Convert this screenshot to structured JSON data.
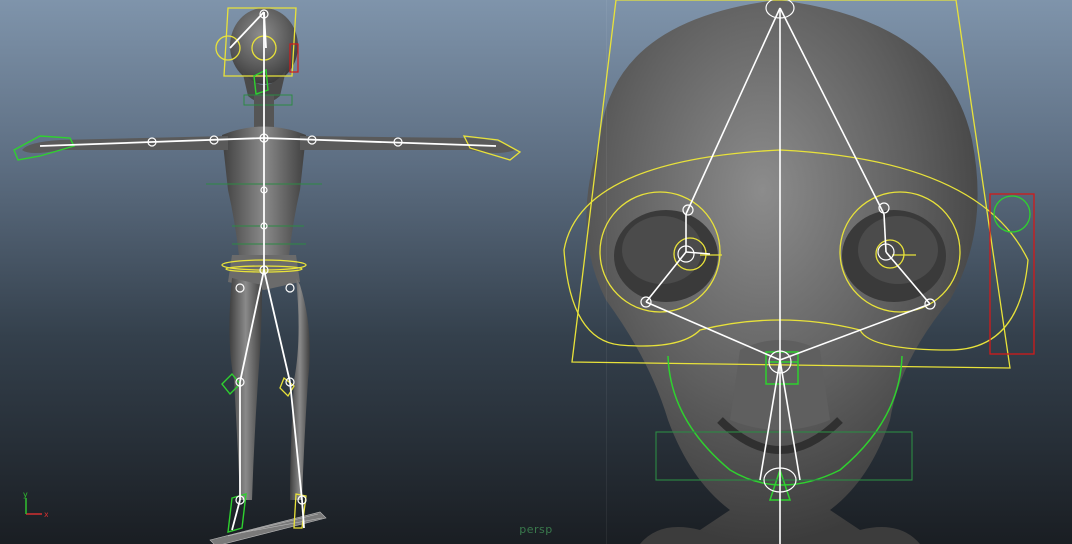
{
  "viewport": {
    "camera_name": "persp",
    "description_colors": {
      "background_top": "#7f94ab",
      "background_bottom": "#1a1e23",
      "mesh": "#6a6a6a",
      "joint": "#ffffff",
      "control_yellow": "#e8e23a",
      "control_green": "#2fd12f",
      "control_darkgreen": "#2c8a44",
      "control_red": "#d21a1a"
    }
  },
  "axis_gizmo": {
    "x_label": "x",
    "y_label": "y",
    "x_color": "#d23030",
    "y_color": "#30c030"
  }
}
